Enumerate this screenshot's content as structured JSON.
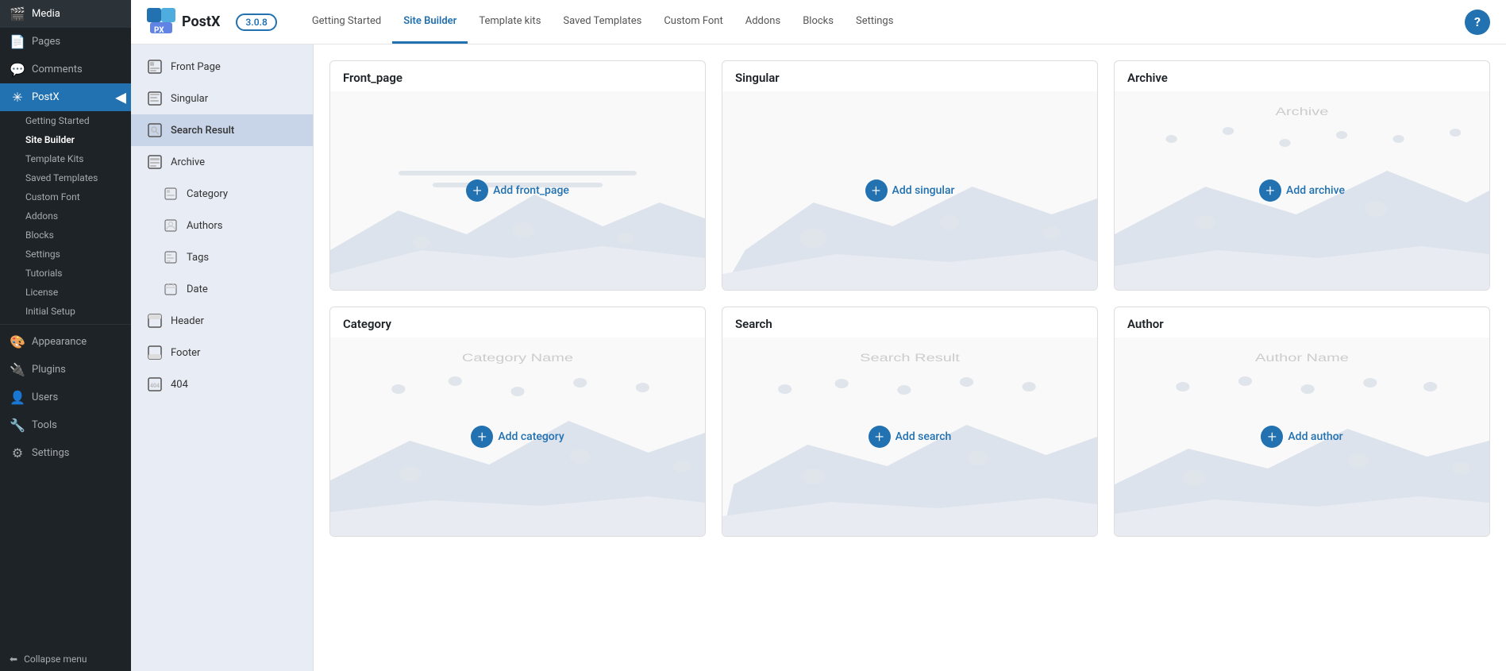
{
  "wp_sidebar": {
    "items": [
      {
        "id": "media",
        "label": "Media",
        "icon": "🎬"
      },
      {
        "id": "pages",
        "label": "Pages",
        "icon": "📄"
      },
      {
        "id": "comments",
        "label": "Comments",
        "icon": "💬"
      },
      {
        "id": "postx",
        "label": "PostX",
        "icon": "✳",
        "active": true
      }
    ],
    "sub_items": [
      {
        "id": "getting-started",
        "label": "Getting Started"
      },
      {
        "id": "site-builder",
        "label": "Site Builder",
        "bold": true
      },
      {
        "id": "template-kits",
        "label": "Template Kits"
      },
      {
        "id": "saved-templates",
        "label": "Saved Templates"
      },
      {
        "id": "custom-font",
        "label": "Custom Font"
      },
      {
        "id": "addons",
        "label": "Addons"
      },
      {
        "id": "blocks",
        "label": "Blocks"
      },
      {
        "id": "settings",
        "label": "Settings"
      },
      {
        "id": "tutorials",
        "label": "Tutorials"
      },
      {
        "id": "license",
        "label": "License"
      },
      {
        "id": "initial-setup",
        "label": "Initial Setup"
      }
    ],
    "bottom_items": [
      {
        "id": "appearance",
        "label": "Appearance",
        "icon": "🎨"
      },
      {
        "id": "plugins",
        "label": "Plugins",
        "icon": "🔌"
      },
      {
        "id": "users",
        "label": "Users",
        "icon": "👤"
      },
      {
        "id": "tools",
        "label": "Tools",
        "icon": "🔧"
      },
      {
        "id": "settings",
        "label": "Settings",
        "icon": "⚙"
      }
    ],
    "collapse_label": "Collapse menu"
  },
  "postx_header": {
    "logo_text": "PostX",
    "version": "3.0.8",
    "nav_items": [
      {
        "id": "getting-started",
        "label": "Getting Started",
        "active": false
      },
      {
        "id": "site-builder",
        "label": "Site Builder",
        "active": true
      },
      {
        "id": "template-kits",
        "label": "Template kits",
        "active": false
      },
      {
        "id": "saved-templates",
        "label": "Saved Templates",
        "active": false
      },
      {
        "id": "custom-font",
        "label": "Custom Font",
        "active": false
      },
      {
        "id": "addons",
        "label": "Addons",
        "active": false
      },
      {
        "id": "blocks",
        "label": "Blocks",
        "active": false
      },
      {
        "id": "settings",
        "label": "Settings",
        "active": false
      }
    ],
    "help_label": "?"
  },
  "postx_sidebar": {
    "items": [
      {
        "id": "front-page",
        "label": "Front Page",
        "icon": "🏠"
      },
      {
        "id": "singular",
        "label": "Singular",
        "icon": "📝"
      },
      {
        "id": "search-result",
        "label": "Search Result",
        "icon": "🔍",
        "active": true
      },
      {
        "id": "archive",
        "label": "Archive",
        "icon": "📁"
      },
      {
        "id": "category",
        "label": "Category",
        "icon": "📂",
        "indent": true
      },
      {
        "id": "authors",
        "label": "Authors",
        "icon": "👤",
        "indent": true
      },
      {
        "id": "tags",
        "label": "Tags",
        "icon": "🏷",
        "indent": true
      },
      {
        "id": "date",
        "label": "Date",
        "icon": "📅",
        "indent": true
      },
      {
        "id": "header",
        "label": "Header",
        "icon": "📋"
      },
      {
        "id": "footer",
        "label": "Footer",
        "icon": "📋"
      },
      {
        "id": "404",
        "label": "404",
        "icon": "❌"
      }
    ]
  },
  "template_cards": [
    {
      "id": "front-page",
      "title": "Front_page",
      "add_label": "Add front_page",
      "type": "generic"
    },
    {
      "id": "singular",
      "title": "Singular",
      "add_label": "Add singular",
      "type": "generic"
    },
    {
      "id": "archive",
      "title": "Archive",
      "add_label": "Add archive",
      "type": "archive-label",
      "card_label": "Archive"
    },
    {
      "id": "category",
      "title": "Category",
      "add_label": "Add category",
      "type": "category-label",
      "card_label": "Category Name"
    },
    {
      "id": "search",
      "title": "Search",
      "add_label": "Add search",
      "type": "search-label",
      "card_label": "Search Result"
    },
    {
      "id": "author",
      "title": "Author",
      "add_label": "Add author",
      "type": "author-label",
      "card_label": "Author Name"
    }
  ]
}
